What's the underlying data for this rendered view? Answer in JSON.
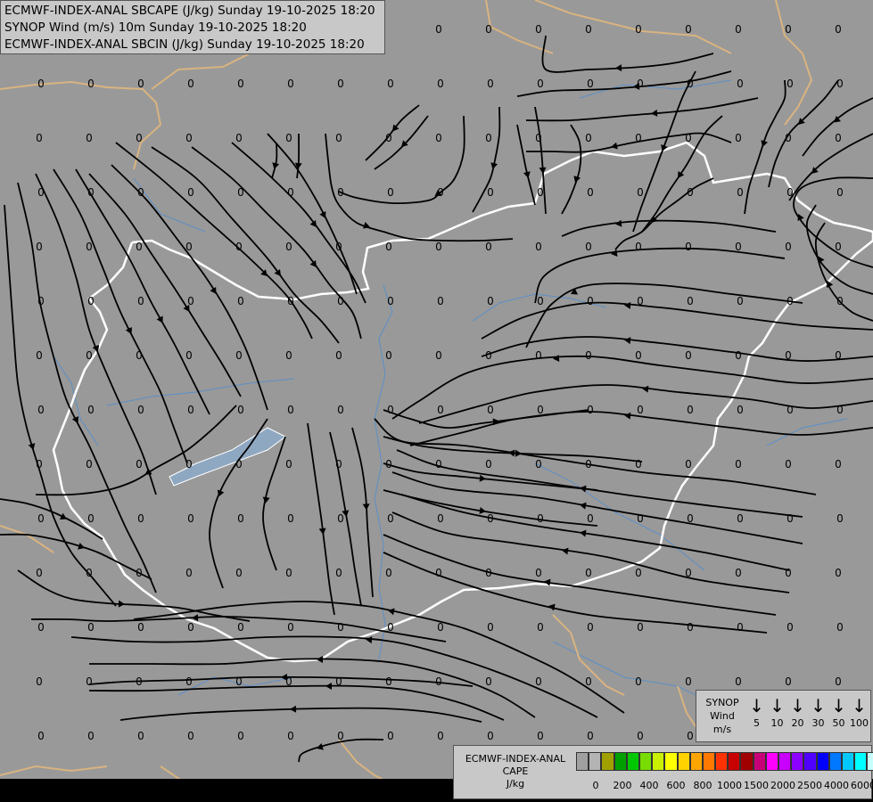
{
  "titles": [
    "ECMWF-INDEX-ANAL SBCAPE (J/kg) Sunday 19-10-2025 18:20",
    "SYNOP Wind (m/s) 10m Sunday 19-10-2025 18:20",
    "ECMWF-INDEX-ANAL SBCIN (J/kg) Sunday 19-10-2025 18:20"
  ],
  "colors": {
    "background": "#999999",
    "national_border": "#ffffff",
    "regional_border": "#d9b380",
    "rivers": "#5b8fc7",
    "streamlines": "#000000"
  },
  "map_value": "0",
  "wind_legend": {
    "title": [
      "SYNOP",
      "Wind",
      "m/s"
    ],
    "values": [
      "5",
      "10",
      "20",
      "30",
      "50",
      "100"
    ]
  },
  "cape_legend": {
    "title": [
      "ECMWF-INDEX-ANAL",
      "CAPE",
      "J/kg"
    ],
    "colors": [
      "#a0a0a0",
      "#b4b4b4",
      "#a0a000",
      "#00a000",
      "#00c800",
      "#78dc00",
      "#c8f000",
      "#ffff00",
      "#ffd200",
      "#ffa500",
      "#ff7800",
      "#ff3200",
      "#c80000",
      "#a00000",
      "#c80078",
      "#ff00ff",
      "#c800ff",
      "#8c00ff",
      "#5000ff",
      "#0000ff",
      "#0078ff",
      "#00c8ff",
      "#00ffff",
      "#c8ffff",
      "#ffffff"
    ],
    "ticks": [
      "0",
      "200",
      "400",
      "600",
      "800",
      "1000",
      "1500",
      "2000",
      "2500",
      "4000",
      "6000"
    ]
  }
}
